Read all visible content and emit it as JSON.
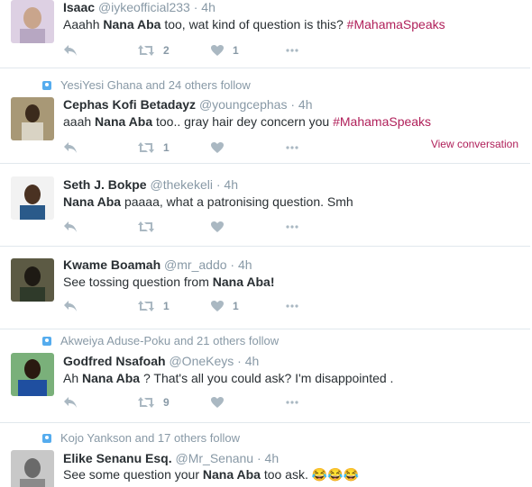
{
  "tweets": [
    {
      "name": "Isaac",
      "handle": "@iykeofficial233",
      "time": "4h",
      "text_before": "Aaahh ",
      "bold": "Nana Aba",
      "text_after": " too, wat kind of question is this? ",
      "hashtag": "#MahamaSpeaks",
      "retweets": "2",
      "likes": "1",
      "avatar_color": "#c9b9cf"
    },
    {
      "context": "YesiYesi Ghana and 24 others follow",
      "name": "Cephas Kofi Betadayz",
      "handle": "@youngcephas",
      "time": "4h",
      "text_before": "aaah ",
      "bold": "Nana Aba",
      "text_after": " too.. gray hair dey concern you ",
      "hashtag": "#MahamaSpeaks",
      "retweets": "1",
      "likes": "",
      "view_conversation": "View conversation",
      "avatar_color": "#8b7a5e"
    },
    {
      "name": "Seth J. Bokpe",
      "handle": "@thekekeli",
      "time": "4h",
      "text_before": "",
      "bold": "Nana Aba",
      "text_after": " paaaa, what a patronising question. Smh",
      "hashtag": "",
      "retweets": "",
      "likes": "",
      "avatar_color": "#2a5a8a"
    },
    {
      "name": "Kwame Boamah",
      "handle": "@mr_addo",
      "time": "4h",
      "text_before": "See tossing question from ",
      "bold": "Nana Aba!",
      "text_after": "",
      "hashtag": "",
      "retweets": "1",
      "likes": "1",
      "avatar_color": "#3a3a2e"
    },
    {
      "context": "Akweiya Aduse-Poku and 21 others follow",
      "name": "Godfred Nsafoah",
      "handle": "@OneKeys",
      "time": "4h",
      "text_before": "Ah ",
      "bold": "Nana Aba",
      "text_after": " ? That's all you could ask? I'm disappointed .",
      "hashtag": "",
      "retweets": "9",
      "likes": "",
      "avatar_color": "#1f4fa0"
    },
    {
      "context": "Kojo Yankson and 17 others follow",
      "name": "Elike Senanu Esq.",
      "handle": "@Mr_Senanu",
      "time": "4h",
      "text_before": "See some question your ",
      "bold": "Nana Aba",
      "text_after": " too ask. ",
      "emoji": "😂😂😂",
      "hashtag": "",
      "retweets": "",
      "likes": "",
      "avatar_color": "#9a9a9a"
    }
  ],
  "colors": {
    "accent": "#b0205a",
    "muted": "#8899a6",
    "follow_icon": "#55acee"
  },
  "icons": {
    "reply": "reply-icon",
    "retweet": "retweet-icon",
    "like": "heart-icon",
    "more": "more-icon",
    "follow": "person-icon"
  }
}
